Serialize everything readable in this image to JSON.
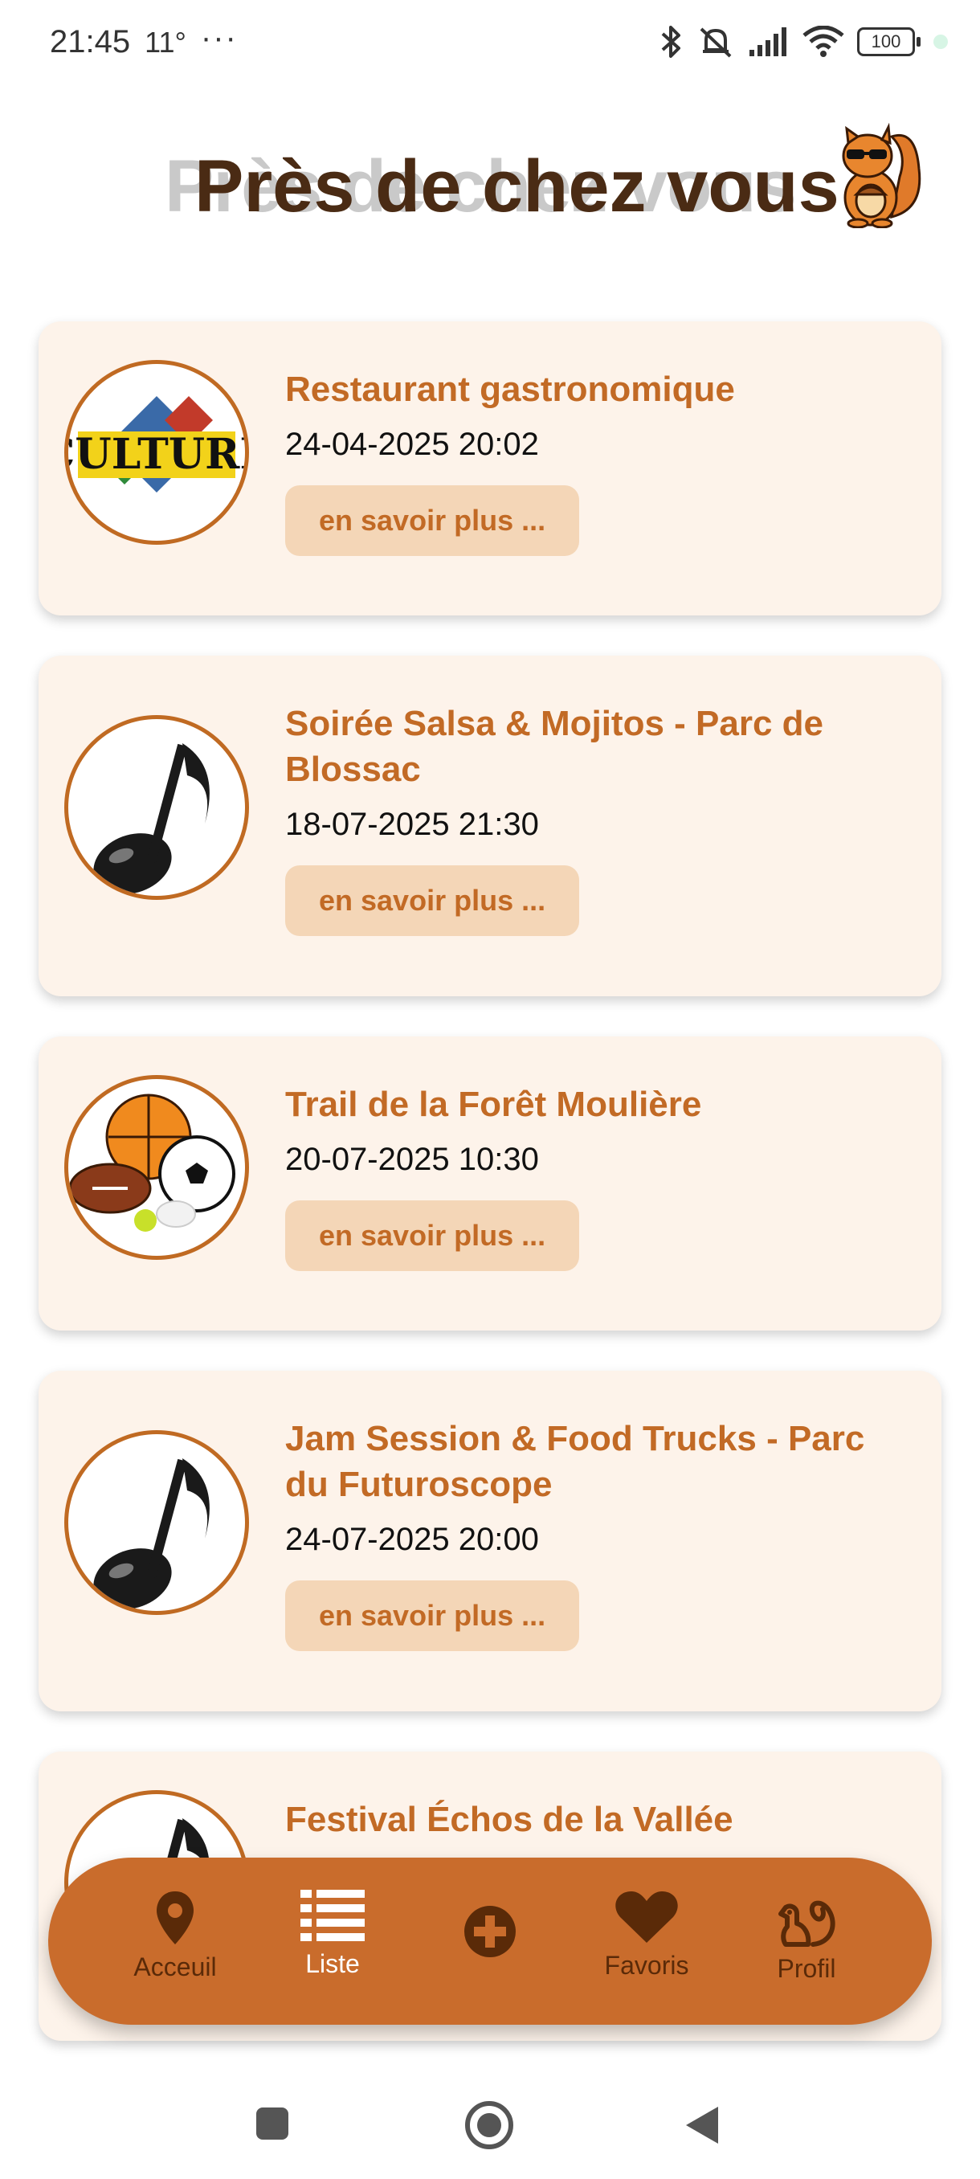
{
  "status_bar": {
    "time": "21:45",
    "temperature": "11°",
    "more": "···",
    "battery": "100"
  },
  "header": {
    "title": "Près de chez vous",
    "title_shadow": "Près de chez vous",
    "mascot_icon": "squirrel-sunglasses-icon"
  },
  "events": [
    {
      "title": "Restaurant gastronomique",
      "date": "24-04-2025 20:02",
      "button": "en savoir plus ...",
      "category_icon": "culture-icon"
    },
    {
      "title": "Soirée Salsa & Mojitos - Parc de Blossac",
      "date": "18-07-2025 21:30",
      "button": "en savoir plus ...",
      "category_icon": "music-note-icon"
    },
    {
      "title": "Trail de la Forêt Moulière",
      "date": "20-07-2025 10:30",
      "button": "en savoir plus ...",
      "category_icon": "sports-balls-icon"
    },
    {
      "title": "Jam Session & Food Trucks - Parc du Futuroscope",
      "date": "24-07-2025 20:00",
      "button": "en savoir plus ...",
      "category_icon": "music-note-icon"
    },
    {
      "title": "Festival Échos de la Vallée",
      "category_icon": "music-note-icon"
    }
  ],
  "bottom_nav": {
    "items": [
      {
        "label": "Acceuil",
        "icon": "map-pin-icon"
      },
      {
        "label": "Liste",
        "icon": "list-icon",
        "active": true
      },
      {
        "label": "",
        "icon": "plus-circle-icon"
      },
      {
        "label": "Favoris",
        "icon": "heart-icon"
      },
      {
        "label": "Profil",
        "icon": "squirrel-icon"
      }
    ]
  },
  "colors": {
    "accent": "#c96c2c",
    "title": "#4a2b14",
    "card_bg": "#fdf3ea",
    "button_bg": "#f4d6b7"
  }
}
